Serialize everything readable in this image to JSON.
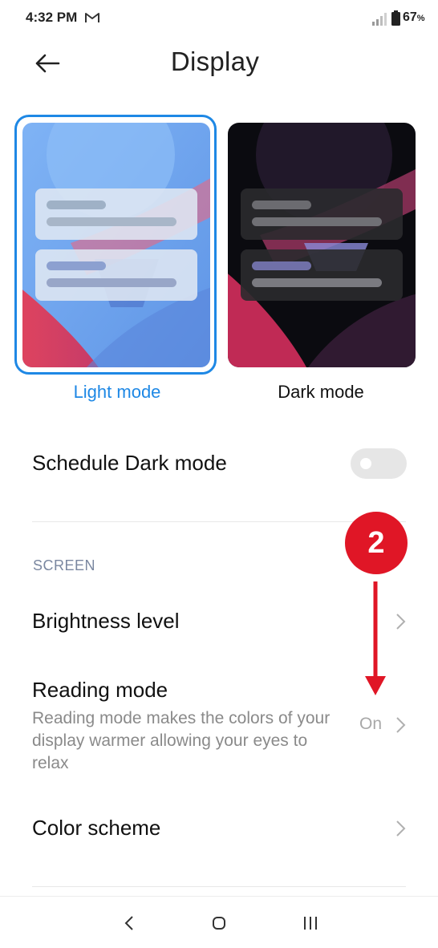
{
  "status_bar": {
    "time": "4:32 PM",
    "battery": "67",
    "battery_unit": "%",
    "icons": [
      "gmail-icon",
      "signal-icon",
      "battery-icon"
    ]
  },
  "header": {
    "title": "Display",
    "back_icon": "back-arrow-icon"
  },
  "theme_modes": [
    {
      "label": "Light mode",
      "selected": true
    },
    {
      "label": "Dark mode",
      "selected": false
    }
  ],
  "schedule_dark_mode": {
    "label": "Schedule Dark mode",
    "enabled": false
  },
  "screen_section": {
    "header": "SCREEN",
    "items": [
      {
        "title": "Brightness level"
      },
      {
        "title": "Reading mode",
        "description": "Reading mode makes the colors of your display warmer allowing your eyes to relax",
        "value": "On"
      },
      {
        "title": "Color scheme"
      }
    ]
  },
  "annotation": {
    "step_number": "2",
    "color": "#e01626"
  },
  "nav_bar": {
    "icons": [
      "back-nav-icon",
      "home-icon",
      "recents-icon"
    ]
  },
  "colors": {
    "accent": "#1e88e5",
    "toggle_off": "#e6e6e6",
    "section_header": "#7a87a0"
  }
}
